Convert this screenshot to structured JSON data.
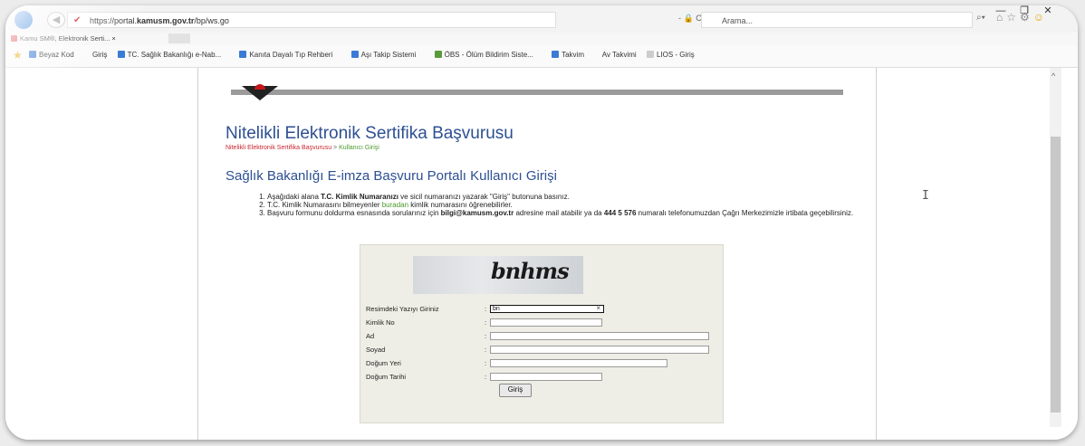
{
  "browser": {
    "url_prefix": "https://portal.",
    "url_domain": "kamusm.gov.tr",
    "url_path": "/bp/ws.go",
    "url_controls": "- 🔒 C",
    "search_placeholder": "Arama...",
    "tab_title": "Kamu SM®, Elektronik Serti... ×"
  },
  "favorites": [
    "Beyaz Kod",
    "Giriş",
    "TC. Sağlık Bakanlığı e-Nab...",
    "Kanıta Dayalı Tıp Rehberi",
    "Aşı Takip Sistemi",
    "ÖBS - Ölüm Bildirim Siste...",
    "Takvim",
    "Av Takvimi",
    "LIOS - Giriş"
  ],
  "page": {
    "title": "Nitelikli Elektronik Sertifika Başvurusu",
    "breadcrumb_root": "Nitelikli Elektronik Sertifika Başvurusu",
    "breadcrumb_sep": " > ",
    "breadcrumb_current": "Kullanıcı Girişi",
    "section_title": "Sağlık Bakanlığı E-imza Başvuru Portalı Kullanıcı Girişi",
    "instructions": {
      "i1_a": "Aşağıdaki alana ",
      "i1_b": "T.C. Kimlik Numaranızı",
      "i1_c": " ve sicil numaranızı yazarak \"Giriş\" butonuna basınız.",
      "i2_a": "T.C. Kimlik Numarasını bilmeyenler ",
      "i2_link": "buradan",
      "i2_c": " kimlik numarasını öğrenebilirler.",
      "i3_a": "Başvuru formunu doldurma esnasında sorularınız için ",
      "i3_b": "bilgi@kamusm.gov.tr",
      "i3_c": " adresine mail atabilir ya da ",
      "i3_d": "444 5 576",
      "i3_e": " numaralı telefonumuzdan Çağrı Merkezimizle irtibata geçebilirsiniz."
    }
  },
  "form": {
    "captcha_text": "bnhms",
    "captcha_label": "Resimdeki Yazıyı Giriniz",
    "captcha_value": "bn",
    "kimlik_label": "Kimlik No",
    "ad_label": "Ad",
    "soyad_label": "Soyad",
    "dogum_yeri_label": "Doğum Yeri",
    "dogum_tarihi_label": "Doğum Tarihi",
    "colon": ":",
    "clear": "×",
    "submit_label": "Giriş"
  },
  "window": {
    "minimize": "—",
    "restore": "❐",
    "close": "✕"
  }
}
